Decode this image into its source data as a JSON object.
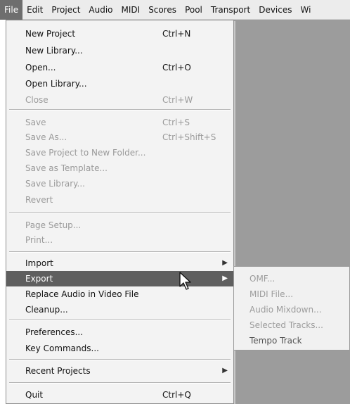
{
  "menubar": {
    "items": [
      "File",
      "Edit",
      "Project",
      "Audio",
      "MIDI",
      "Scores",
      "Pool",
      "Transport",
      "Devices",
      "Wi"
    ]
  },
  "file_menu": {
    "items": [
      {
        "label": "New Project",
        "shortcut": "Ctrl+N",
        "enabled": true
      },
      {
        "label": "New Library...",
        "shortcut": "",
        "enabled": true
      },
      {
        "label": "Open...",
        "shortcut": "Ctrl+O",
        "enabled": true
      },
      {
        "label": "Open Library...",
        "shortcut": "",
        "enabled": true
      },
      {
        "label": "Close",
        "shortcut": "Ctrl+W",
        "enabled": false
      },
      {
        "label": "Save",
        "shortcut": "Ctrl+S",
        "enabled": false
      },
      {
        "label": "Save As...",
        "shortcut": "Ctrl+Shift+S",
        "enabled": false
      },
      {
        "label": "Save Project to New Folder...",
        "shortcut": "",
        "enabled": false
      },
      {
        "label": "Save as Template...",
        "shortcut": "",
        "enabled": false
      },
      {
        "label": "Save Library...",
        "shortcut": "",
        "enabled": false
      },
      {
        "label": "Revert",
        "shortcut": "",
        "enabled": false
      },
      {
        "label": "Page Setup...",
        "shortcut": "",
        "enabled": false
      },
      {
        "label": "Print...",
        "shortcut": "",
        "enabled": false
      },
      {
        "label": "Import",
        "shortcut": "",
        "enabled": true,
        "submenu": true
      },
      {
        "label": "Export",
        "shortcut": "",
        "enabled": true,
        "submenu": true,
        "highlighted": true
      },
      {
        "label": "Replace Audio in Video File",
        "shortcut": "",
        "enabled": true
      },
      {
        "label": "Cleanup...",
        "shortcut": "",
        "enabled": true
      },
      {
        "label": "Preferences...",
        "shortcut": "",
        "enabled": true
      },
      {
        "label": "Key Commands...",
        "shortcut": "",
        "enabled": true
      },
      {
        "label": "Recent Projects",
        "shortcut": "",
        "enabled": true,
        "submenu": true
      },
      {
        "label": "Quit",
        "shortcut": "Ctrl+Q",
        "enabled": true
      }
    ]
  },
  "export_submenu": {
    "items": [
      {
        "label": "OMF...",
        "enabled": false
      },
      {
        "label": "MIDI File...",
        "enabled": false
      },
      {
        "label": "Audio Mixdown...",
        "enabled": false
      },
      {
        "label": "Selected Tracks...",
        "enabled": false
      },
      {
        "label": "Tempo Track",
        "enabled": true
      }
    ]
  },
  "icons": {
    "submenu_arrow": "chevron-right-icon",
    "cursor": "mouse-pointer-icon"
  },
  "colors": {
    "menubar_bg": "#ececec",
    "menu_bg": "#f3f3f3",
    "highlight_bg": "#5f5f5f",
    "workspace_bg": "#9c9c9c",
    "disabled_text": "#9a9a9a"
  }
}
